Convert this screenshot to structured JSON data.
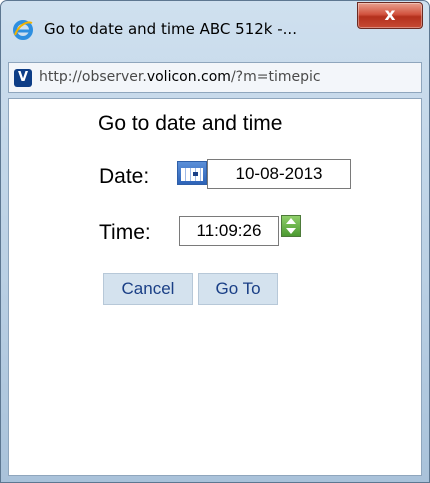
{
  "window": {
    "title": "Go to date and time ABC 512k -...",
    "close_label": "x"
  },
  "addressbar": {
    "site_icon_letter": "V",
    "url_prefix": "http://observer.",
    "url_domain": "volicon.com",
    "url_suffix": "/?m=timepic"
  },
  "dialog": {
    "heading": "Go to date and time",
    "date_label": "Date:",
    "date_value": "10-08-2013",
    "time_label": "Time:",
    "time_value": "11:09:26",
    "cancel_label": "Cancel",
    "goto_label": "Go To"
  },
  "icons": {
    "browser": "internet-explorer-icon",
    "site": "volicon-favicon",
    "calendar": "calendar-icon",
    "spinner": "up-down-spinner-icon"
  },
  "colors": {
    "titlebar": "#cfe0ef",
    "close_button": "#c64a33",
    "button_bg": "#d4e2ee",
    "button_text": "#1a3f86"
  }
}
